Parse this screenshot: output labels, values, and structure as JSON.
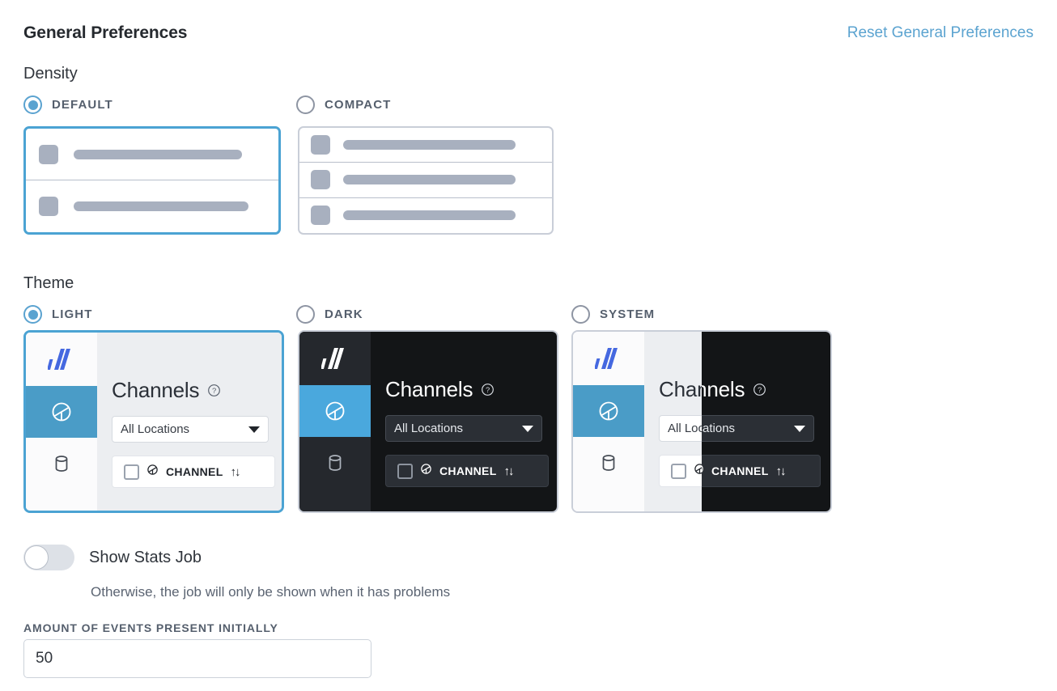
{
  "header": {
    "title": "General Preferences",
    "reset_link": "Reset General Preferences"
  },
  "density": {
    "label": "Density",
    "options": [
      {
        "label": "DEFAULT",
        "selected": true,
        "rows": 2
      },
      {
        "label": "COMPACT",
        "selected": false,
        "rows": 3
      }
    ]
  },
  "theme": {
    "label": "Theme",
    "options": [
      {
        "label": "LIGHT",
        "selected": true,
        "mode": "light"
      },
      {
        "label": "DARK",
        "selected": false,
        "mode": "dark"
      },
      {
        "label": "SYSTEM",
        "selected": false,
        "mode": "system"
      }
    ],
    "preview": {
      "heading": "Channels",
      "help_icon": "question-circle-icon",
      "location_select": "All Locations",
      "column_header": "CHANNEL",
      "sort_icon": "sort-updown-icon",
      "logo_icon": "app-logo-icon",
      "nav_icons": [
        "channels-icon",
        "database-icon"
      ]
    }
  },
  "stats_job": {
    "label": "Show Stats Job",
    "enabled": false,
    "help_text": "Otherwise, the job will only be shown when it has problems"
  },
  "events_field": {
    "label": "AMOUNT OF EVENTS PRESENT INITIALLY",
    "value": "50",
    "placeholder": ""
  },
  "colors": {
    "accent": "#5ba3d0",
    "link": "#5ba3d0",
    "selected_border": "#4ba3d3",
    "dark_bg": "#16181a",
    "dark_panel": "#26292e",
    "dark_accent": "#4aa8dd",
    "logo_blue": "#4568e0",
    "muted": "#a8b0bf"
  }
}
